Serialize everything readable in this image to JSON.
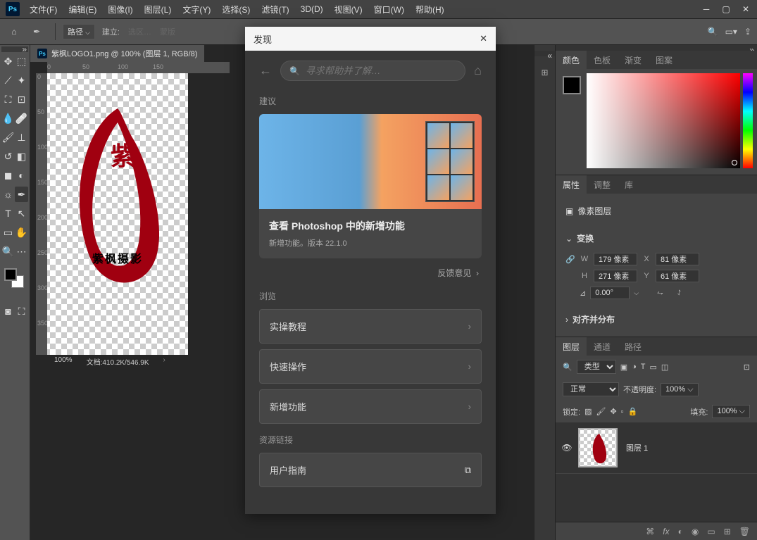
{
  "menu": {
    "file": "文件(F)",
    "edit": "编辑(E)",
    "image": "图像(I)",
    "layer": "图层(L)",
    "text": "文字(Y)",
    "select": "选择(S)",
    "filter": "滤镜(T)",
    "threed": "3D(D)",
    "view": "视图(V)",
    "window": "窗口(W)",
    "help": "帮助(H)"
  },
  "options": {
    "path": "路径",
    "build": "建立:",
    "selection": "选区…",
    "mask": "蒙版"
  },
  "doc": {
    "title": "紫枫LOGO1.png @ 100% (图层 1, RGB/8)",
    "zoom": "100%",
    "size": "文档:410.2K/546.9K",
    "logo_text": "紫枫摄影"
  },
  "discover": {
    "title": "发现",
    "search_placeholder": "寻求帮助并了解…",
    "suggest": "建议",
    "card_title": "查看 Photoshop 中的新增功能",
    "card_sub": "新增功能。版本 22.1.0",
    "feedback": "反馈意见",
    "browse": "浏览",
    "tutorial": "实操教程",
    "quick": "快速操作",
    "new_features": "新增功能",
    "resources": "资源链接",
    "guide": "用户指南"
  },
  "panels": {
    "color": "颜色",
    "swatches": "色板",
    "gradient": "渐变",
    "pattern": "图案",
    "properties": "属性",
    "adjust": "调整",
    "library": "库",
    "pixel_layer": "像素图层",
    "transform": "变换",
    "align": "对齐并分布",
    "w": "W",
    "h": "H",
    "x": "X",
    "y": "Y",
    "w_val": "179 像素",
    "h_val": "271 像素",
    "x_val": "81 像素",
    "y_val": "61 像素",
    "angle": "0.00°",
    "layers": "图层",
    "channels": "通道",
    "paths": "路径",
    "kind": "类型",
    "blend": "正常",
    "opacity": "不透明度:",
    "opacity_val": "100%",
    "lock": "锁定:",
    "fill": "填充:",
    "fill_val": "100%",
    "layer1": "图层 1"
  },
  "rulers_h": [
    "0",
    "50",
    "100",
    "150"
  ],
  "rulers_v": [
    "0",
    "50",
    "100",
    "150",
    "200",
    "250",
    "300",
    "350"
  ]
}
